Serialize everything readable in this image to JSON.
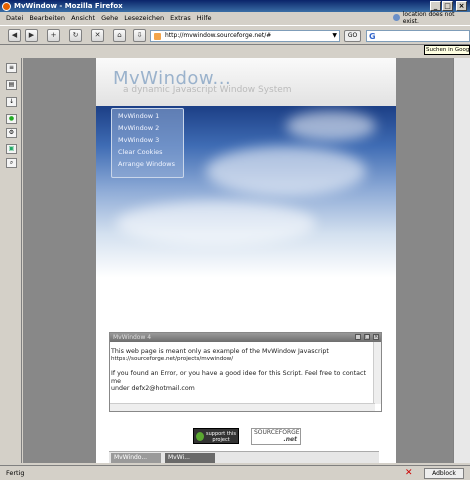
{
  "window": {
    "title": "MvWindow - Mozilla Firefox",
    "min": "_",
    "max": "□",
    "close": "×"
  },
  "menu": [
    "Datei",
    "Bearbeiten",
    "Ansicht",
    "Gehe",
    "Lesezeichen",
    "Extras",
    "Hilfe"
  ],
  "location_status": "location does not exist.",
  "nav": {
    "url": "http://mvwindow.sourceforge.net/#",
    "url_dropdown": "▼",
    "go": "GO",
    "search_engine": "G",
    "tooltip": "Suchen in Google"
  },
  "page": {
    "logo": "MvWindow...",
    "tagline": "a dynamic Javascript Window System",
    "menu_items": [
      "MvWindow 1",
      "MvWindow 2",
      "MvWindow 3",
      "Clear Cookies",
      "Arrange Windows"
    ],
    "dialog": {
      "title": "MvWindow 4",
      "line1": "This web page is meant only as example of the MvWindow Javascript",
      "line2": "https://sourceforge.net/projects/mvwindow/",
      "line3": "If you found an Error, or you have a good idee for this Script. Feel free to contact me",
      "line4": "under defx2@hotmail.com"
    },
    "support_badge": "support this project",
    "sf_logo": "SOURCEFORGE",
    "sf_net": ".net",
    "taskbar": [
      "MvWindo...",
      "MvWi..."
    ]
  },
  "status": {
    "text": "Fertig",
    "adblock": "Adblock"
  }
}
